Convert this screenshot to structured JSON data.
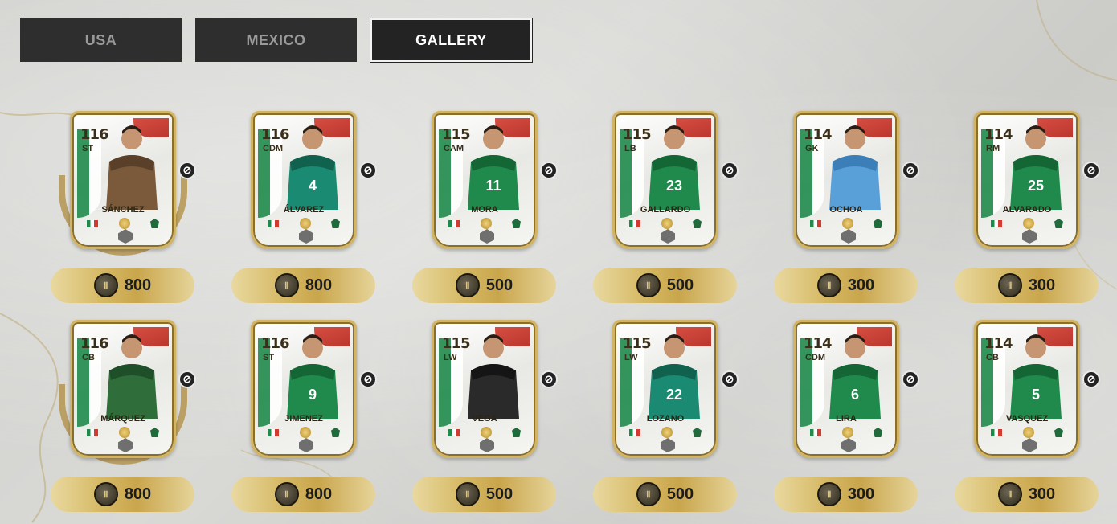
{
  "tabs": [
    {
      "label": "USA",
      "active": false
    },
    {
      "label": "MEXICO",
      "active": false
    },
    {
      "label": "GALLERY",
      "active": true
    }
  ],
  "colors": {
    "tab_bg": "#2e2e2e",
    "active_tab_text": "#ffffff",
    "inactive_tab_text": "#9a9a9a",
    "card_gold": "#d2b463",
    "mexico_green": "#1f8a4c",
    "mexico_red": "#d23b2f",
    "price_gold": "#d6b965"
  },
  "icons": {
    "coin": "token-coin-icon",
    "untradeable": "untradeable-icon"
  },
  "cards": [
    {
      "name": "SÁNCHEZ",
      "rating": "116",
      "position": "ST",
      "price": "800",
      "kit": "brown",
      "laurel": true,
      "number": ""
    },
    {
      "name": "ÁLVAREZ",
      "rating": "116",
      "position": "CDM",
      "price": "800",
      "kit": "teal",
      "laurel": false,
      "number": "4"
    },
    {
      "name": "MORA",
      "rating": "115",
      "position": "CAM",
      "price": "500",
      "kit": "green",
      "laurel": false,
      "number": "11"
    },
    {
      "name": "GALLARDO",
      "rating": "115",
      "position": "LB",
      "price": "500",
      "kit": "green",
      "laurel": false,
      "number": "23"
    },
    {
      "name": "OCHOA",
      "rating": "114",
      "position": "GK",
      "price": "300",
      "kit": "blue",
      "laurel": false,
      "number": ""
    },
    {
      "name": "ALVARADO",
      "rating": "114",
      "position": "RM",
      "price": "300",
      "kit": "green",
      "laurel": false,
      "number": "25"
    },
    {
      "name": "MÁRQUEZ",
      "rating": "116",
      "position": "CB",
      "price": "800",
      "kit": "darkgreen",
      "laurel": true,
      "number": ""
    },
    {
      "name": "JIMENEZ",
      "rating": "116",
      "position": "ST",
      "price": "800",
      "kit": "green",
      "laurel": false,
      "number": "9"
    },
    {
      "name": "VEGA",
      "rating": "115",
      "position": "LW",
      "price": "500",
      "kit": "black",
      "laurel": false,
      "number": ""
    },
    {
      "name": "LOZANO",
      "rating": "115",
      "position": "LW",
      "price": "500",
      "kit": "teal",
      "laurel": false,
      "number": "22"
    },
    {
      "name": "LIRA",
      "rating": "114",
      "position": "CDM",
      "price": "300",
      "kit": "green",
      "laurel": false,
      "number": "6"
    },
    {
      "name": "VASQUEZ",
      "rating": "114",
      "position": "CB",
      "price": "300",
      "kit": "green",
      "laurel": false,
      "number": "5"
    }
  ]
}
